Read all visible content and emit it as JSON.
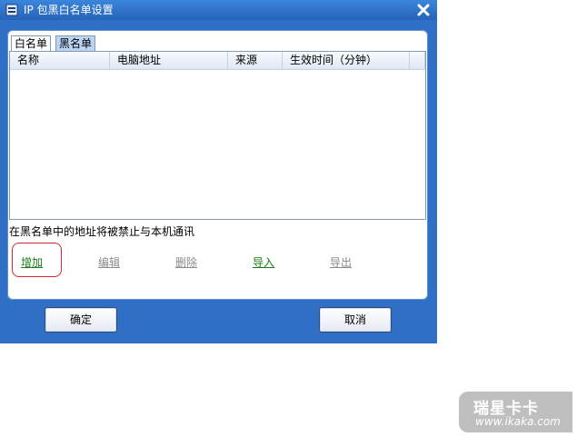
{
  "window": {
    "title": "IP 包黑白名单设置"
  },
  "tabs": [
    {
      "label": "白名单"
    },
    {
      "label": "黑名单"
    }
  ],
  "table": {
    "columns": [
      "名称",
      "电脑地址",
      "来源",
      "生效时间（分钟）"
    ],
    "rows": []
  },
  "info_text": "在黑名单中的地址将被禁止与本机通讯",
  "actions": {
    "add": "增加",
    "edit": "编辑",
    "delete": "删除",
    "import": "导入",
    "export": "导出"
  },
  "buttons": {
    "ok": "确定",
    "cancel": "取消"
  },
  "watermark": {
    "logo": "瑞星卡卡",
    "url": "www.ikaka.com"
  },
  "colors": {
    "window_frame": "#2f6fc6",
    "enabled_action": "#1a7d1a",
    "disabled_action": "#8a8a8a",
    "highlight": "#d42a2a"
  }
}
